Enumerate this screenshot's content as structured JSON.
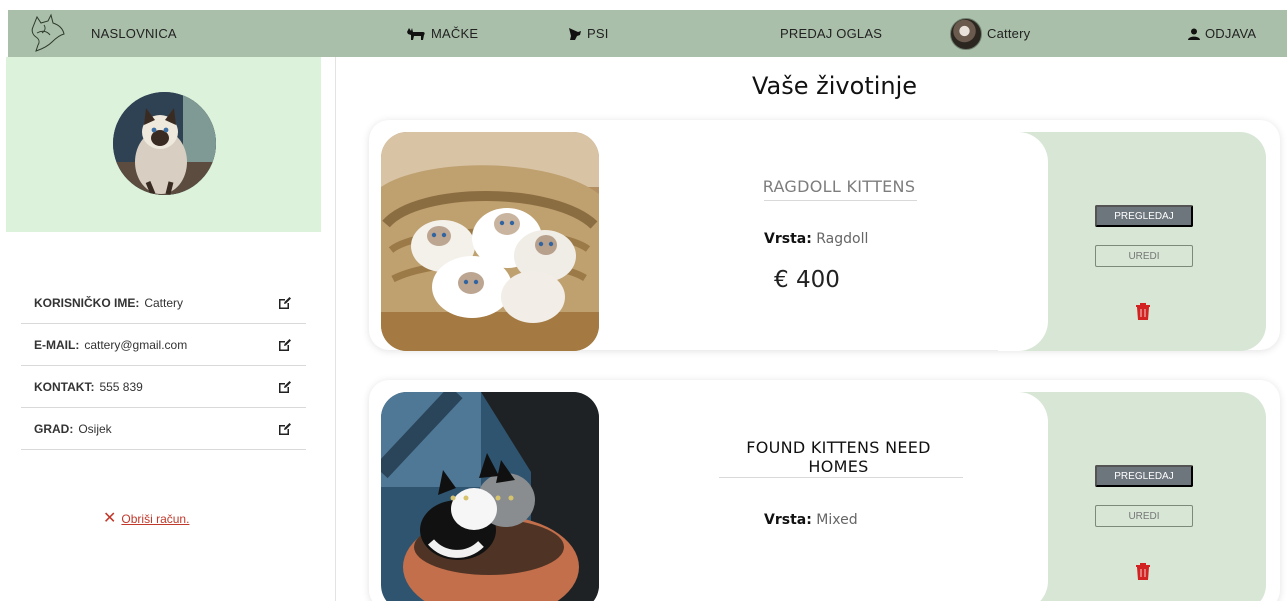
{
  "nav": {
    "home": "NASLOVNICA",
    "cats": "MAČKE",
    "dogs": "PSI",
    "post_ad": "PREDAJ OGLAS",
    "profile": "Cattery",
    "logout": "ODJAVA"
  },
  "sidebar": {
    "fields": [
      {
        "label": "KORISNIČKO IME:",
        "value": "Cattery"
      },
      {
        "label": "E-MAIL:",
        "value": "cattery@gmail.com"
      },
      {
        "label": "KONTAKT:",
        "value": "555 839"
      },
      {
        "label": "GRAD:",
        "value": "Osijek"
      }
    ],
    "delete_mark": "✕",
    "delete_account": "Obriši račun."
  },
  "main": {
    "title": "Vaše životinje",
    "animals": [
      {
        "title": "RAGDOLL KITTENS",
        "breed_label": "Vrsta:",
        "breed": "Ragdoll",
        "price": "€ 400",
        "view": "PREGLEDAJ",
        "edit": "UREDI"
      },
      {
        "title": "FOUND KITTENS NEED HOMES",
        "breed_label": "Vrsta:",
        "breed": "Mixed",
        "view": "PREGLEDAJ",
        "edit": "UREDI"
      }
    ]
  },
  "colors": {
    "navbar": "#a9bfa9",
    "profile_panel": "#dcf2da",
    "actions_panel": "#d7e6d5",
    "button_primary": "#6d757d",
    "danger": "#c0392b"
  },
  "icons": {
    "logo": "cat-dog-logo-icon",
    "cats": "cat-icon",
    "dogs": "dog-icon",
    "user": "user-icon",
    "edit": "edit-icon",
    "trash": "trash-icon"
  }
}
